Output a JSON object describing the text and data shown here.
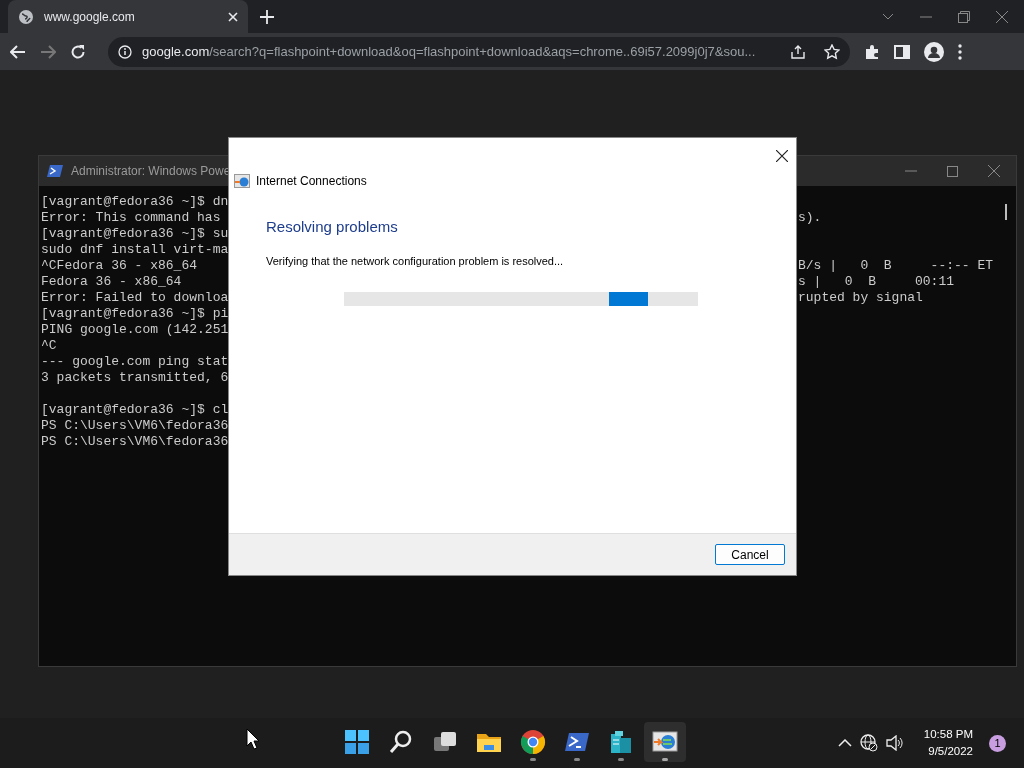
{
  "browser": {
    "tab": {
      "title": "www.google.com"
    },
    "url": {
      "host": "google.com",
      "path": "/search?q=flashpoint+download&oq=flashpoint+download&aqs=chrome..69i57.2099j0j7&sou..."
    }
  },
  "terminal": {
    "title": "Administrator: Windows Powe",
    "lines": [
      {
        "kind": "text",
        "left": "[vagrant@fedora36 ~]$ dn"
      },
      {
        "kind": "text",
        "left": "Error: This command has",
        "right": "s)."
      },
      {
        "kind": "text",
        "left": "[vagrant@fedora36 ~]$ su"
      },
      {
        "kind": "text",
        "left": "sudo dnf install virt-ma"
      },
      {
        "kind": "text",
        "left": "^CFedora 36 - x86_64",
        "right": "B/s |   0  B     --:-- ET"
      },
      {
        "kind": "text",
        "left": "Fedora 36 - x86_64",
        "right": "s |   0  B     00:11"
      },
      {
        "kind": "text",
        "left": "Error: Failed to downloa",
        "right": "rupted by signal"
      },
      {
        "kind": "text",
        "left": "[vagrant@fedora36 ~]$ pi"
      },
      {
        "kind": "text",
        "left": "PING google.com (142.251"
      },
      {
        "kind": "text",
        "left": "^C"
      },
      {
        "kind": "text",
        "left": "--- google.com ping stat"
      },
      {
        "kind": "text",
        "left": "3 packets transmitted, 6"
      },
      {
        "kind": "blank"
      },
      {
        "kind": "text",
        "left": "[vagrant@fedora36 ~]$ cl"
      },
      {
        "kind": "text",
        "left": "PS C:\\Users\\VM6\\fedora36"
      },
      {
        "kind": "text",
        "left": "PS C:\\Users\\VM6\\fedora36"
      }
    ]
  },
  "dialog": {
    "title": "Internet Connections",
    "heading": "Resolving problems",
    "message": "Verifying that the network configuration problem is resolved...",
    "progress": {
      "level": 0.86
    },
    "buttons": [
      "Cancel"
    ]
  },
  "taskbar": {
    "apps": [
      {
        "kind": "start",
        "running": false,
        "selected": false
      },
      {
        "kind": "search",
        "running": false,
        "selected": false
      },
      {
        "kind": "taskview",
        "running": false,
        "selected": false
      },
      {
        "kind": "explorer",
        "running": false,
        "selected": false
      },
      {
        "kind": "chrome",
        "running": true,
        "selected": false
      },
      {
        "kind": "terminal",
        "running": true,
        "selected": false
      },
      {
        "kind": "server",
        "running": true,
        "selected": false
      },
      {
        "kind": "network",
        "running": true,
        "selected": true
      }
    ],
    "time": "10:58 PM",
    "date": "9/5/2022",
    "notifications": "1"
  }
}
